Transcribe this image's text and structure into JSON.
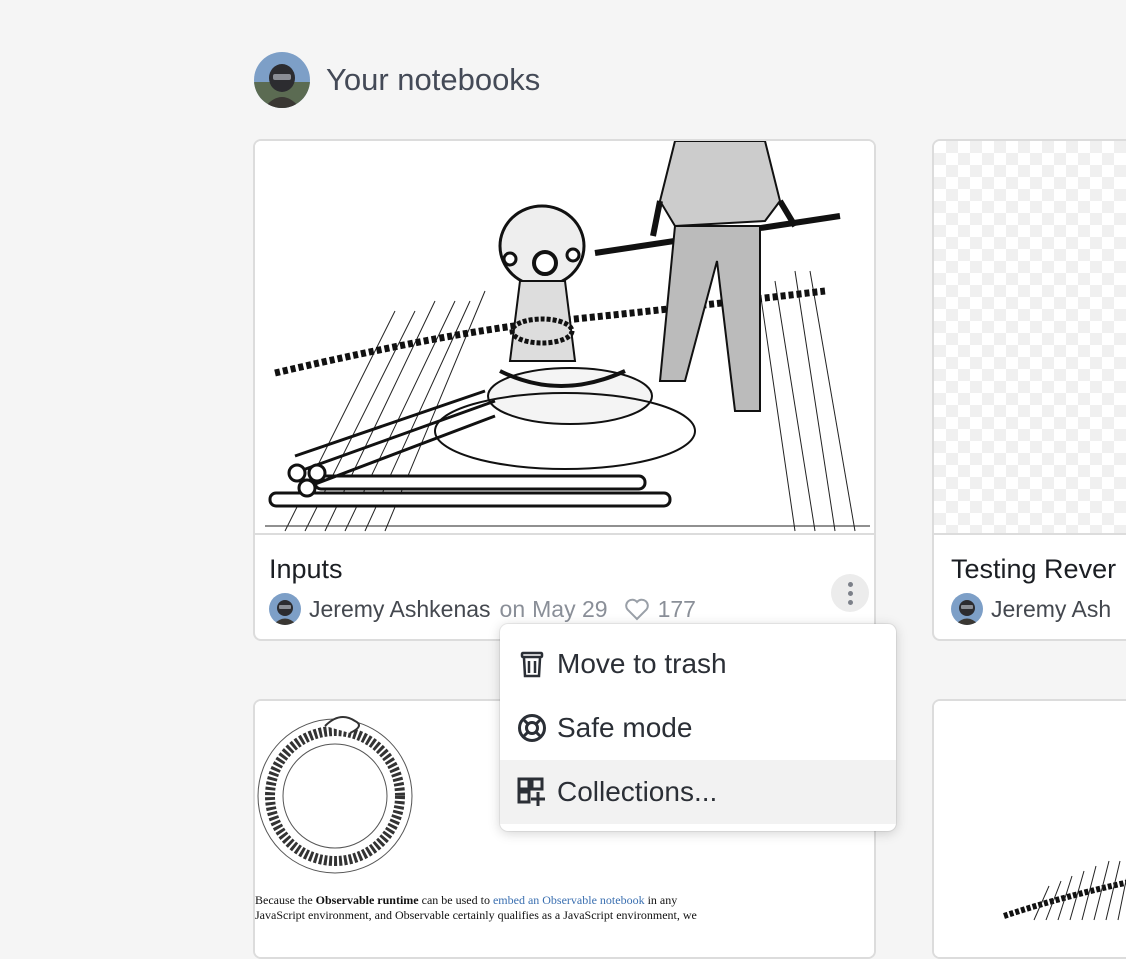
{
  "header": {
    "title": "Your notebooks"
  },
  "notebooks": [
    {
      "title": "Inputs",
      "author": "Jeremy Ashkenas",
      "date_prefix": "on",
      "date": "May 29",
      "likes": "177"
    },
    {
      "title": "Testing Rever",
      "author": "Jeremy Ash"
    }
  ],
  "context_menu": {
    "items": [
      {
        "label": "Move to trash",
        "icon": "trash-icon"
      },
      {
        "label": "Safe mode",
        "icon": "lifebuoy-icon"
      },
      {
        "label": "Collections...",
        "icon": "add-collection-icon"
      }
    ]
  },
  "preview_text": {
    "part1": "Because the ",
    "bold": "Observable runtime",
    "part2": " can be used to ",
    "link": "embed an Observable notebook",
    "part3": " in any",
    "line2": "JavaScript environment, and Observable certainly qualifies as a JavaScript environment, we"
  }
}
